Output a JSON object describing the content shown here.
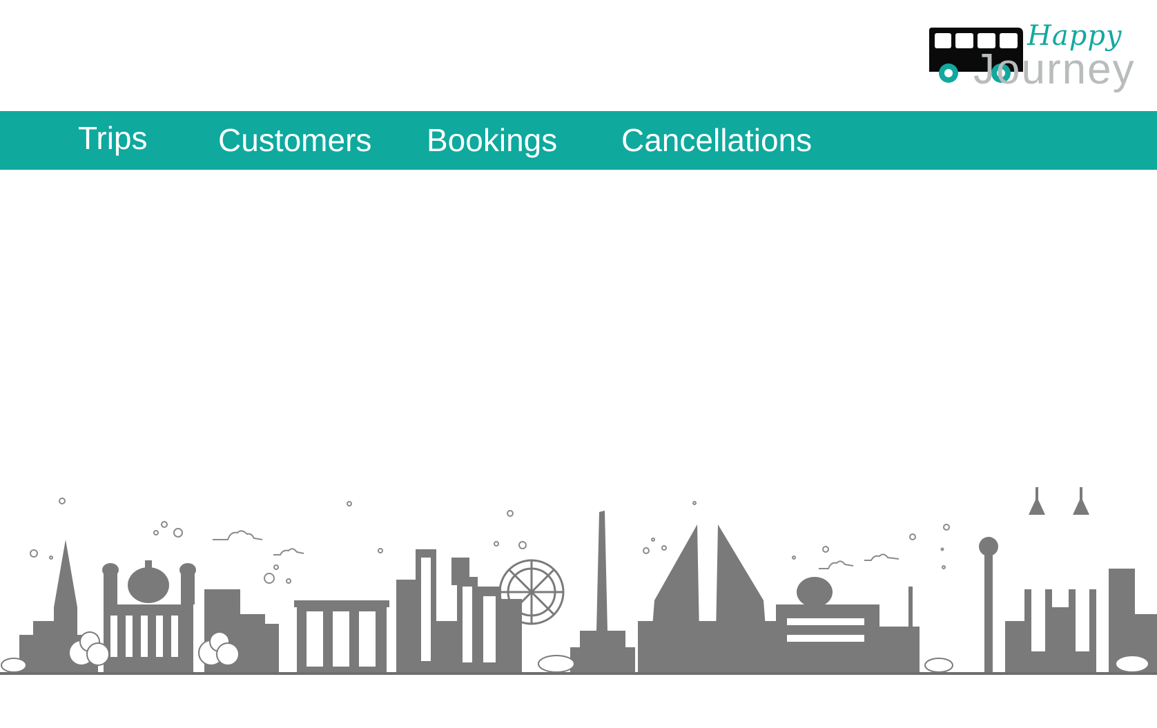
{
  "brand": {
    "script": "Happy",
    "word": "Journey",
    "script_color": "#13a89e",
    "word_color": "#b9bcbd",
    "icon": "bus-icon"
  },
  "nav": {
    "background": "#0fa99e",
    "items": [
      {
        "label": "Trips"
      },
      {
        "label": "Customers"
      },
      {
        "label": "Bookings"
      },
      {
        "label": "Cancellations"
      }
    ]
  },
  "footer_illustration": {
    "icon": "city-skyline-illustration",
    "color": "#7a7a7a"
  }
}
